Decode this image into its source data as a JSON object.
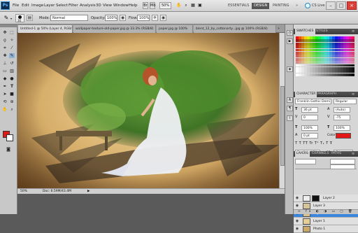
{
  "menubar": {
    "logo": "Ps",
    "menus": [
      "File",
      "Edit",
      "Image",
      "Layer",
      "Select",
      "Filter",
      "Analysis",
      "3D",
      "View",
      "Window",
      "Help"
    ],
    "zoom": "50%",
    "workspaces": [
      "ESSENTIALS",
      "DESIGN",
      "PAINTING"
    ],
    "active_workspace": "DESIGN",
    "more": "»",
    "cs_live": "CS Live",
    "minimize": "–",
    "maximize": "□",
    "close": "×"
  },
  "options": {
    "brush_size": "30",
    "mode_label": "Mode:",
    "mode_value": "Normal",
    "opacity_label": "Opacity:",
    "opacity_value": "100%",
    "flow_label": "Flow:",
    "flow_value": "100%"
  },
  "tabs": [
    "Untitled-1 @ 50% (Layer 4, RGB/8) *",
    "wallpaper-texture-old-paper.jpg @ 33.3% (RGB/8)",
    "paper.jpg @ 100%",
    "blent_12_by_cottonarty...jpg @ 100% (RGB/8)"
  ],
  "status": {
    "zoom": "50%",
    "doc": "Doc: 6.59M/43.4M"
  },
  "colors": {
    "foreground": "#e51616",
    "background": "#ffffff",
    "selection": "#3a86dc"
  },
  "swatches": {
    "tabs": [
      "SWATCHES",
      "STYLES"
    ]
  },
  "character": {
    "tabs": [
      "CHARACTER",
      "PARAGRAPH"
    ],
    "font": "Franklin Gothic Demi",
    "style": "Regular",
    "size": "36 pt",
    "leading": "(Auto)",
    "kerning": "0",
    "tracking": "-75",
    "vscale": "100%",
    "hscale": "100%",
    "baseline": "0 pt",
    "color_label": "Color:",
    "language": "English: USA",
    "aa_label": "aa",
    "antialias": "Crisp"
  },
  "layers": {
    "tabs": [
      "LAYERS",
      "CHANNELS",
      "PATHS"
    ],
    "items": [
      {
        "name": "Layer 2"
      },
      {
        "name": "Layer 3"
      },
      {
        "name": "Layer 4"
      },
      {
        "name": "Layer 1"
      },
      {
        "name": "Photo 1"
      }
    ]
  }
}
